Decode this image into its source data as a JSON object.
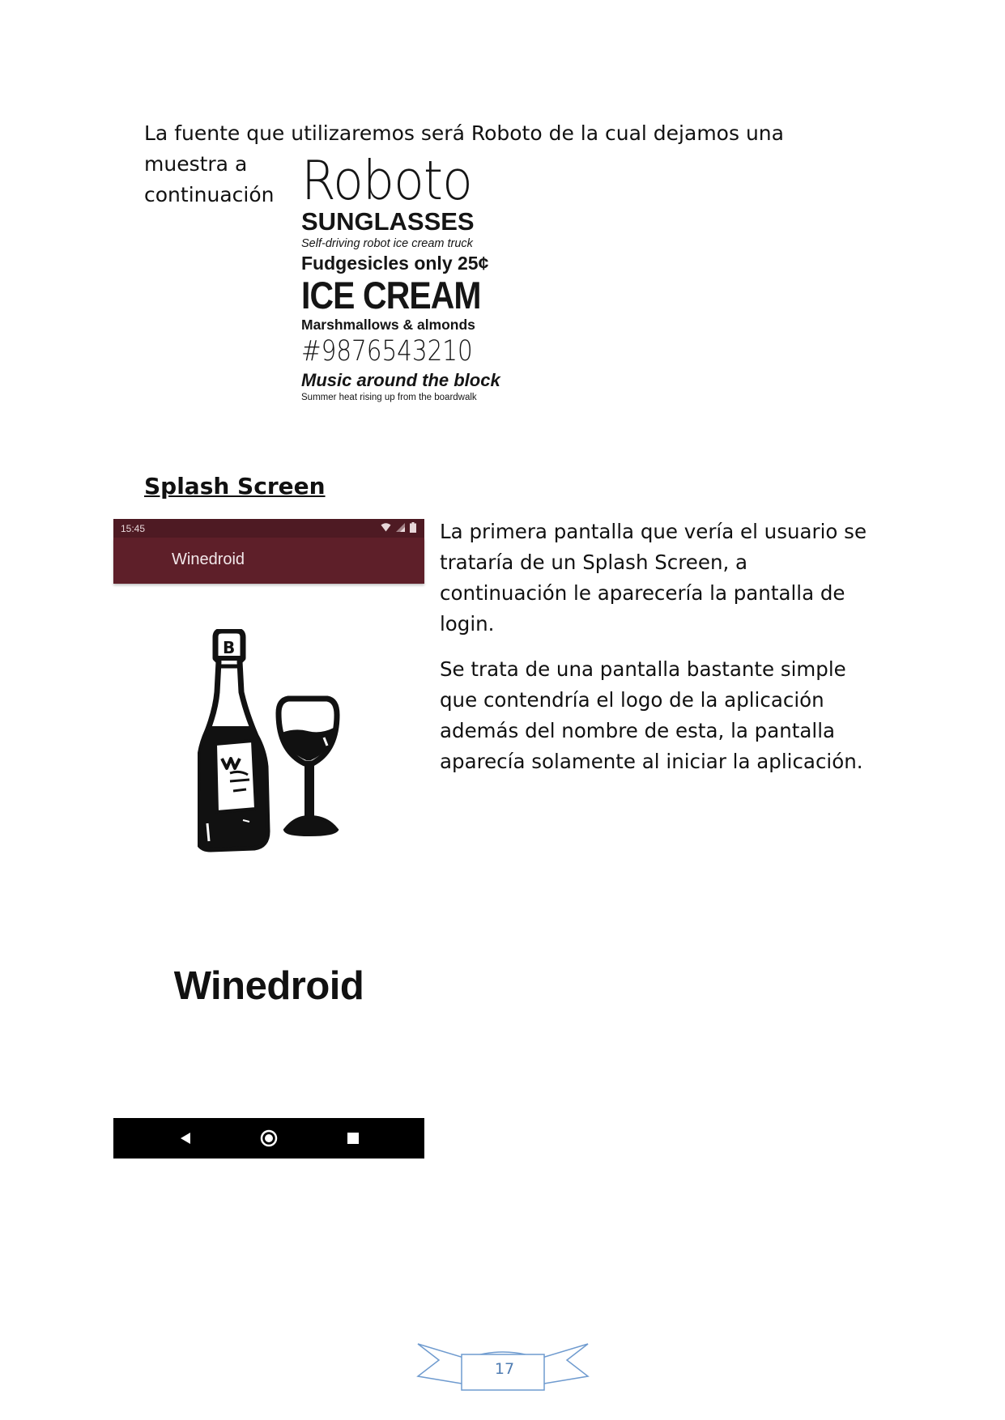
{
  "intro": {
    "line1": "La fuente que utilizaremos será Roboto de la cual dejamos una muestra a",
    "line2": "continuación"
  },
  "specimen": {
    "title": "Roboto",
    "sunglasses": "SUNGLASSES",
    "self_driving": "Self-driving robot ice cream truck",
    "fudgesicles": "Fudgesicles only 25¢",
    "ice_cream": "ICE CREAM",
    "marshmallows": "Marshmallows & almonds",
    "digits": "#9876543210",
    "music": "Music around the block",
    "summer": "Summer heat rising up from the boardwalk"
  },
  "section": {
    "heading": "Splash Screen"
  },
  "phone": {
    "status_time": "15:45",
    "app_bar_title": "Winedroid",
    "app_name": "Winedroid",
    "colors": {
      "status_bar": "#4e1a23",
      "app_bar": "#5e1f29"
    }
  },
  "description": {
    "p1": "La primera pantalla que vería el usuario se trataría de un Splash Screen, a continuación le aparecería la pantalla de login.",
    "p2": "Se trata de una pantalla bastante simple que contendría el logo de la aplicación además del nombre de esta, la pantalla aparecía solamente al iniciar la aplicación."
  },
  "footer": {
    "page_number": "17",
    "accent_color": "#4f7cb2"
  }
}
